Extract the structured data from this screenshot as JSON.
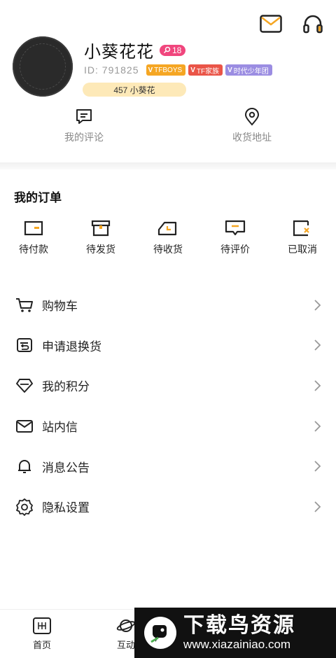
{
  "header": {
    "icons": [
      "mail-icon",
      "headset-icon"
    ],
    "accent_color": "#f5a623"
  },
  "profile": {
    "name": "小葵花花",
    "level": "18",
    "id_text": "ID: 791825",
    "tags": [
      {
        "label": "TFBOYS",
        "color": "#f5a623"
      },
      {
        "label": "TF家族",
        "color": "#ea5548"
      },
      {
        "label": "时代少年团",
        "color": "#9b8de2"
      }
    ],
    "fans_text": "457 小葵花"
  },
  "quick_links": [
    {
      "label": "我的评论",
      "icon": "comment-icon"
    },
    {
      "label": "收货地址",
      "icon": "location-icon"
    }
  ],
  "orders": {
    "title": "我的订单",
    "items": [
      {
        "label": "待付款",
        "icon": "wallet-icon"
      },
      {
        "label": "待发货",
        "icon": "package-icon"
      },
      {
        "label": "待收货",
        "icon": "truck-icon"
      },
      {
        "label": "待评价",
        "icon": "review-icon"
      },
      {
        "label": "已取消",
        "icon": "cancelled-icon"
      }
    ]
  },
  "menu": [
    {
      "label": "购物车",
      "icon": "cart-icon"
    },
    {
      "label": "申请退换货",
      "icon": "return-icon"
    },
    {
      "label": "我的积分",
      "icon": "diamond-icon"
    },
    {
      "label": "站内信",
      "icon": "envelope-icon"
    },
    {
      "label": "消息公告",
      "icon": "bell-icon"
    },
    {
      "label": "隐私设置",
      "icon": "settings-icon"
    }
  ],
  "bottom_nav": [
    {
      "label": "首页",
      "icon": "home-icon"
    },
    {
      "label": "互动",
      "icon": "planet-icon"
    }
  ],
  "watermark": {
    "title": "下载鸟资源",
    "url": "www.xiazainiao.com"
  }
}
